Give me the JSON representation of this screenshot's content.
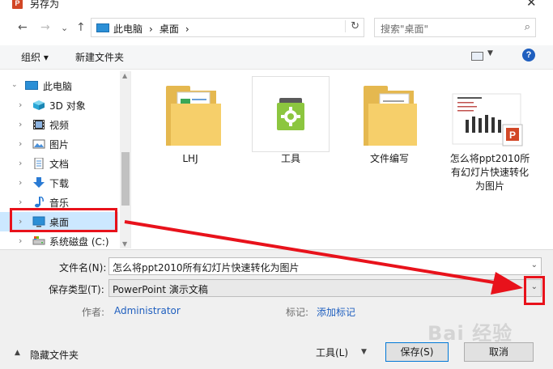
{
  "window": {
    "title": "另存为",
    "app_icon_letter": "P",
    "close_glyph": "✕"
  },
  "nav": {
    "back": "←",
    "forward": "→",
    "recent": "⌄",
    "up": "↑",
    "address": [
      "此电脑",
      "›",
      "桌面",
      "›"
    ],
    "refresh": "↻",
    "search_placeholder": "搜索\"桌面\"",
    "search_icon": "⌕"
  },
  "toolbar": {
    "organize": "组织 ▾",
    "new_folder": "新建文件夹",
    "help": "?"
  },
  "sidebar": {
    "items": [
      {
        "label": "此电脑",
        "icon": "computer-icon"
      },
      {
        "label": "3D 对象",
        "icon": "3d-objects-icon"
      },
      {
        "label": "视频",
        "icon": "video-icon"
      },
      {
        "label": "图片",
        "icon": "pictures-icon"
      },
      {
        "label": "文档",
        "icon": "documents-icon"
      },
      {
        "label": "下载",
        "icon": "downloads-icon"
      },
      {
        "label": "音乐",
        "icon": "music-icon"
      },
      {
        "label": "桌面",
        "icon": "desktop-icon",
        "selected": true
      },
      {
        "label": "系统磁盘 (C:)",
        "icon": "drive-icon"
      }
    ]
  },
  "files": [
    {
      "name": "LHJ",
      "type": "folder"
    },
    {
      "name": "工具",
      "type": "app-folder"
    },
    {
      "name": "文件编写",
      "type": "folder"
    },
    {
      "name": "怎么将ppt2010所有幻灯片快速转化为图片",
      "type": "pptx"
    }
  ],
  "form": {
    "filename_label": "文件名(N):",
    "filename_value": "怎么将ppt2010所有幻灯片快速转化为图片",
    "savetype_label": "保存类型(T):",
    "savetype_value": "PowerPoint 演示文稿",
    "author_label": "作者:",
    "author_value": "Administrator",
    "tags_label": "标记:",
    "tags_value": "添加标记"
  },
  "footer": {
    "hide_folders": "隐藏文件夹",
    "tools": "工具(L)",
    "save": "保存(S)",
    "cancel": "取消"
  },
  "watermark": "Bai 经验",
  "colors": {
    "annotation_red": "#e8121b",
    "selection": "#cce8ff",
    "link": "#1f5fbf"
  }
}
